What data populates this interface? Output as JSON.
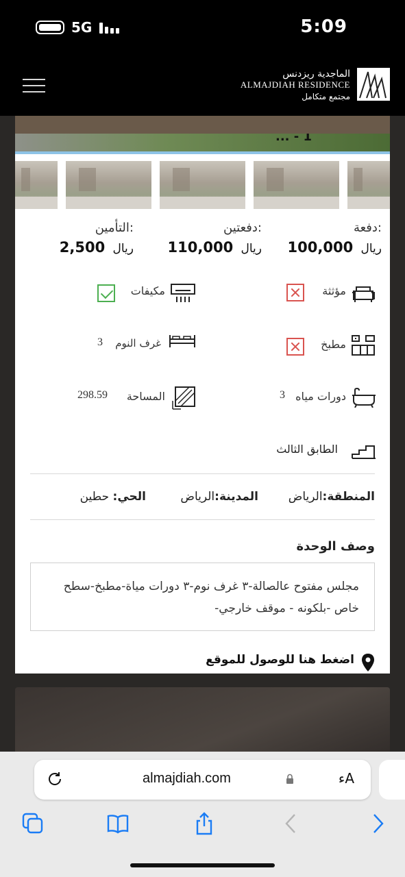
{
  "status_bar": {
    "network": "5G",
    "time": "5:09"
  },
  "header": {
    "logo_arabic": "الماجدية ريزدنس",
    "logo_english": "ALMAJDIAH RESIDENCE",
    "logo_tagline": "مجتمع متكامل"
  },
  "listing": {
    "title_fragment": "... - 1",
    "prices": [
      {
        "label": "دفعة:",
        "amount": "100,000",
        "currency": "ريال"
      },
      {
        "label": "دفعتين:",
        "amount": "110,000",
        "currency": "ريال"
      },
      {
        "label": "التأمين:",
        "amount": "2,500",
        "currency": "ريال"
      }
    ],
    "features": {
      "furnished": {
        "label": "مؤثثة",
        "included": false
      },
      "ac": {
        "label": "مكيفات",
        "included": true
      },
      "kitchen": {
        "label": "مطبخ",
        "included": false
      },
      "bedrooms": {
        "label": "غرف النوم",
        "value": "3"
      },
      "bathrooms": {
        "label": "دورات مياه",
        "value": "3"
      },
      "area": {
        "label": "المساحة",
        "value": "298.59"
      },
      "floor": {
        "label": "الطابق الثالث"
      }
    },
    "location": {
      "region_label": "المنطقة:",
      "region_value": "الرياض",
      "city_label": "المدينة:",
      "city_value": "الرياض",
      "district_label": "الحي:",
      "district_value": "حطين"
    },
    "description_title": "وصف الوحدة",
    "description": "مجلس مفتوح عالصالة-٣ غرف نوم-٣ دورات مياة-مطبخ-سطح خاص -بلكونه - موقف خارجي-",
    "map_link": "اضغط هنا للوصول للموقع"
  },
  "browser": {
    "domain": "almajdiah.com",
    "text_size_button": "ءA"
  },
  "icons": {
    "reload": "reload-icon",
    "lock": "lock-icon",
    "tabs": "tabs-icon",
    "bookmarks": "bookmarks-icon",
    "share": "share-icon",
    "back": "back-chevron-icon",
    "forward": "forward-chevron-icon",
    "pin": "location-pin-icon"
  },
  "colors": {
    "accent_blue": "#1a7cf5",
    "check_green": "#4caf50",
    "cross_red": "#d9534f"
  }
}
